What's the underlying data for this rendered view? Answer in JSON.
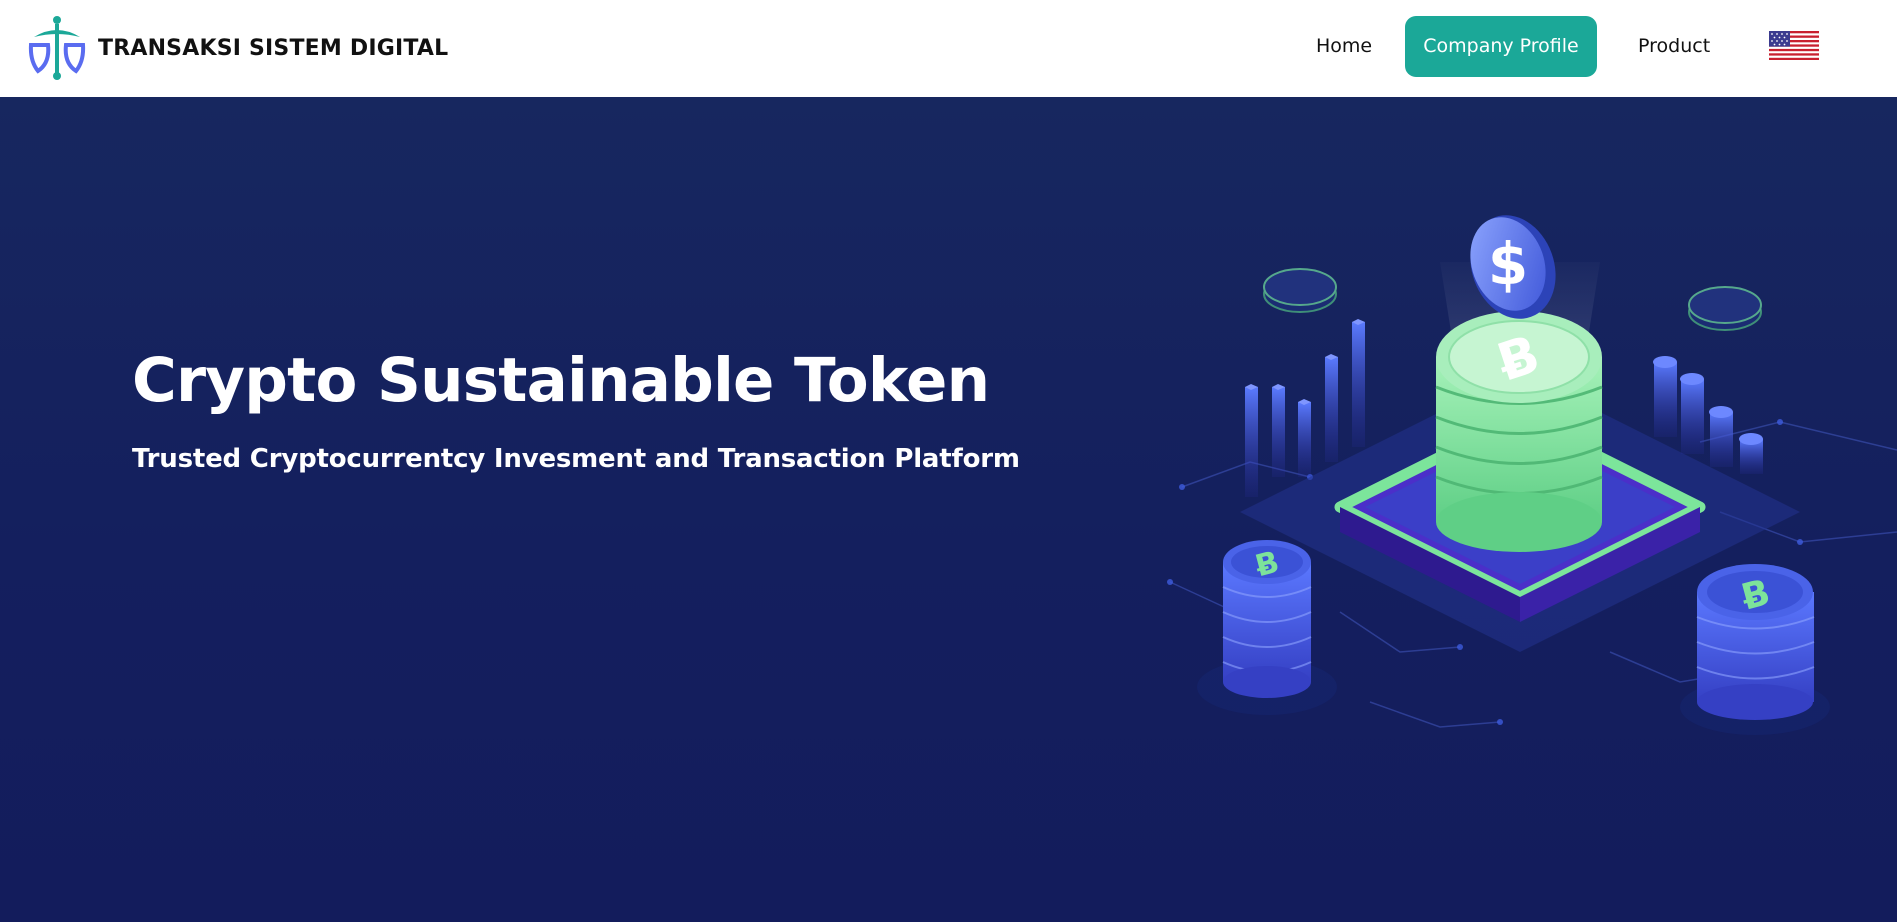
{
  "header": {
    "brand_name": "TRANSAKSI SISTEM DIGITAL",
    "logo_icon": "tsd-logo-icon",
    "nav": {
      "home": "Home",
      "company_profile": "Company Profile",
      "product": "Product"
    },
    "language_icon": "us-flag-icon",
    "active_color": "#1ba898"
  },
  "hero": {
    "title": "Crypto Sustainable Token",
    "subtitle": "Trusted Cryptocurrentcy Invesment and Transaction Platform",
    "illustration_icon": "crypto-token-isometric-illustration",
    "background_color": "#15215e",
    "accent_green": "#7de39a",
    "accent_blue": "#4a63e8"
  }
}
